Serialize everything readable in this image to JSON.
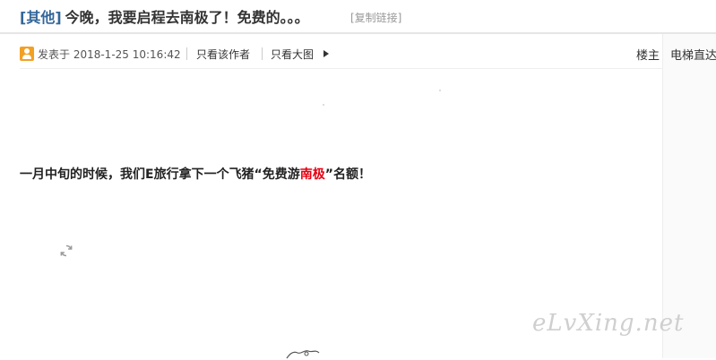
{
  "thread": {
    "category": "[其他]",
    "title": "今晚，我要启程去南极了！免费的。。。",
    "copy_link": "[复制链接]"
  },
  "post": {
    "posted_at": "发表于 2018-1-25 10:16:42",
    "author_only": "只看该作者",
    "big_image": "只看大图",
    "floor": "楼主",
    "elevator": "电梯直达"
  },
  "content": {
    "headline_before": "一月中旬的时候，我们E旅行拿下一个飞猪“免费游",
    "headline_highlight": "南极",
    "headline_after": "”名额！"
  },
  "watermark": "eLvXing.net",
  "colors": {
    "highlight": "#e60012",
    "category": "#336699",
    "user_icon": "#f2a024"
  }
}
